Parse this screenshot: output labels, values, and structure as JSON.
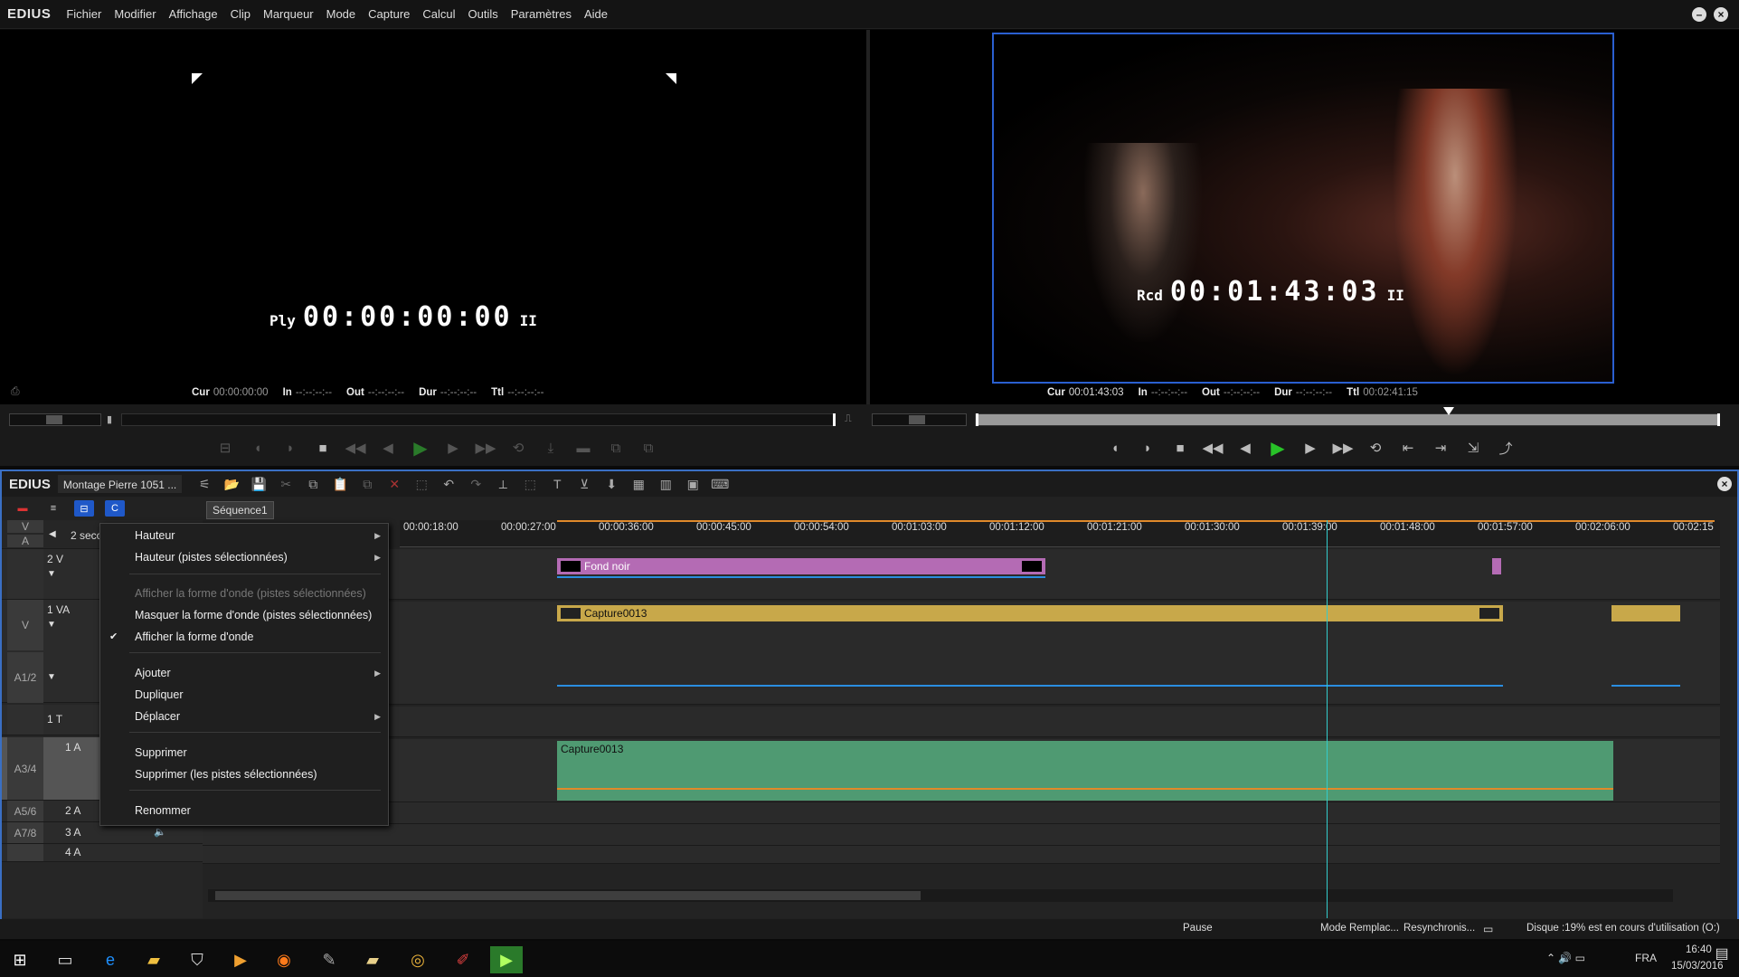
{
  "app": {
    "logo": "EDIUS"
  },
  "menu": [
    "Fichier",
    "Modifier",
    "Affichage",
    "Clip",
    "Marqueur",
    "Mode",
    "Capture",
    "Calcul",
    "Outils",
    "Paramètres",
    "Aide"
  ],
  "window_controls": {
    "minimize": "–",
    "close": "×"
  },
  "player": {
    "label": "Ply",
    "timecode": "00:00:00:00",
    "pause_icon": "II",
    "cur_label": "Cur",
    "cur": "00:00:00:00",
    "in_label": "In",
    "in": "--:--:--:--",
    "out_label": "Out",
    "out": "--:--:--:--",
    "dur_label": "Dur",
    "dur": "--:--:--:--",
    "ttl_label": "Ttl",
    "ttl": "--:--:--:--"
  },
  "recorder": {
    "label": "Rcd",
    "timecode": "00:01:43:03",
    "pause_icon": "II",
    "cur_label": "Cur",
    "cur": "00:01:43:03",
    "in_label": "In",
    "in": "--:--:--:--",
    "out_label": "Out",
    "out": "--:--:--:--",
    "dur_label": "Dur",
    "dur": "--:--:--:--",
    "ttl_label": "Ttl",
    "ttl": "00:02:41:15"
  },
  "timeline": {
    "logo": "EDIUS",
    "project_name": "Montage Pierre 1051 ...",
    "sequence_tab": "Séquence1",
    "zoom_label": "2 secc",
    "ruler": [
      "00:00:18:00",
      "00:00:27:00",
      "00:00:36:00",
      "00:00:45:00",
      "00:00:54:00",
      "00:01:03:00",
      "00:01:12:00",
      "00:01:21:00",
      "00:01:30:00",
      "00:01:39:00",
      "00:01:48:00",
      "00:01:57:00",
      "00:02:06:00",
      "00:02:15"
    ],
    "tracks": {
      "v_label": "V",
      "a_label": "A",
      "t2v": "2 V",
      "t1va": "1 VA",
      "side_v": "V",
      "side_a12": "A1/2",
      "t1t": "1 T",
      "t1a": "1 A",
      "side_a34": "A3/4",
      "t2a": "2 A",
      "t3a": "3 A",
      "t4a": "4 A",
      "side_a56": "A5/6",
      "side_a78": "A7/8"
    },
    "clips": {
      "fond_noir": "Fond noir",
      "capture_video": "Capture0013",
      "capture_audio": "Capture0013"
    },
    "colors": {
      "fond_noir": "#b46bb4",
      "capture_video": "#c8a84a",
      "capture_audio": "#4f9a72",
      "cursor": "#33cccc",
      "frame": "#3a6fc4"
    }
  },
  "context_menu": {
    "items": [
      {
        "label": "Hauteur",
        "submenu": true,
        "disabled": false
      },
      {
        "label": "Hauteur (pistes sélectionnées)",
        "submenu": true,
        "disabled": false
      },
      {
        "label": "Afficher la forme d'onde (pistes sélectionnées)",
        "submenu": false,
        "disabled": true
      },
      {
        "label": "Masquer la forme d'onde (pistes sélectionnées)",
        "submenu": false,
        "disabled": false
      },
      {
        "label": "Afficher la forme d'onde",
        "submenu": false,
        "disabled": false,
        "checked": true
      },
      {
        "label": "Ajouter",
        "submenu": true,
        "disabled": false
      },
      {
        "label": "Dupliquer",
        "submenu": false,
        "disabled": false
      },
      {
        "label": "Déplacer",
        "submenu": true,
        "disabled": false
      },
      {
        "label": "Supprimer",
        "submenu": false,
        "disabled": false
      },
      {
        "label": "Supprimer (les pistes sélectionnées)",
        "submenu": false,
        "disabled": false
      },
      {
        "label": "Renommer",
        "submenu": false,
        "disabled": false
      }
    ],
    "check_mark": "✔",
    "submenu_arrow": "▶"
  },
  "statusbar": {
    "state": "Pause",
    "mode": "Mode Remplac...",
    "resync": "Resynchronis...",
    "disk": "Disque :19% est en cours d'utilisation (O:)"
  },
  "taskbar": {
    "icons": [
      "windows-start-icon",
      "task-view-icon",
      "edge-icon",
      "file-explorer-icon",
      "store-icon",
      "media-player-icon",
      "firefox-icon",
      "app-icon",
      "folder-icon",
      "chrome-icon",
      "app-icon-2",
      "edius-icon"
    ],
    "lang": "FRA",
    "time": "16:40",
    "date": "15/03/2016"
  }
}
